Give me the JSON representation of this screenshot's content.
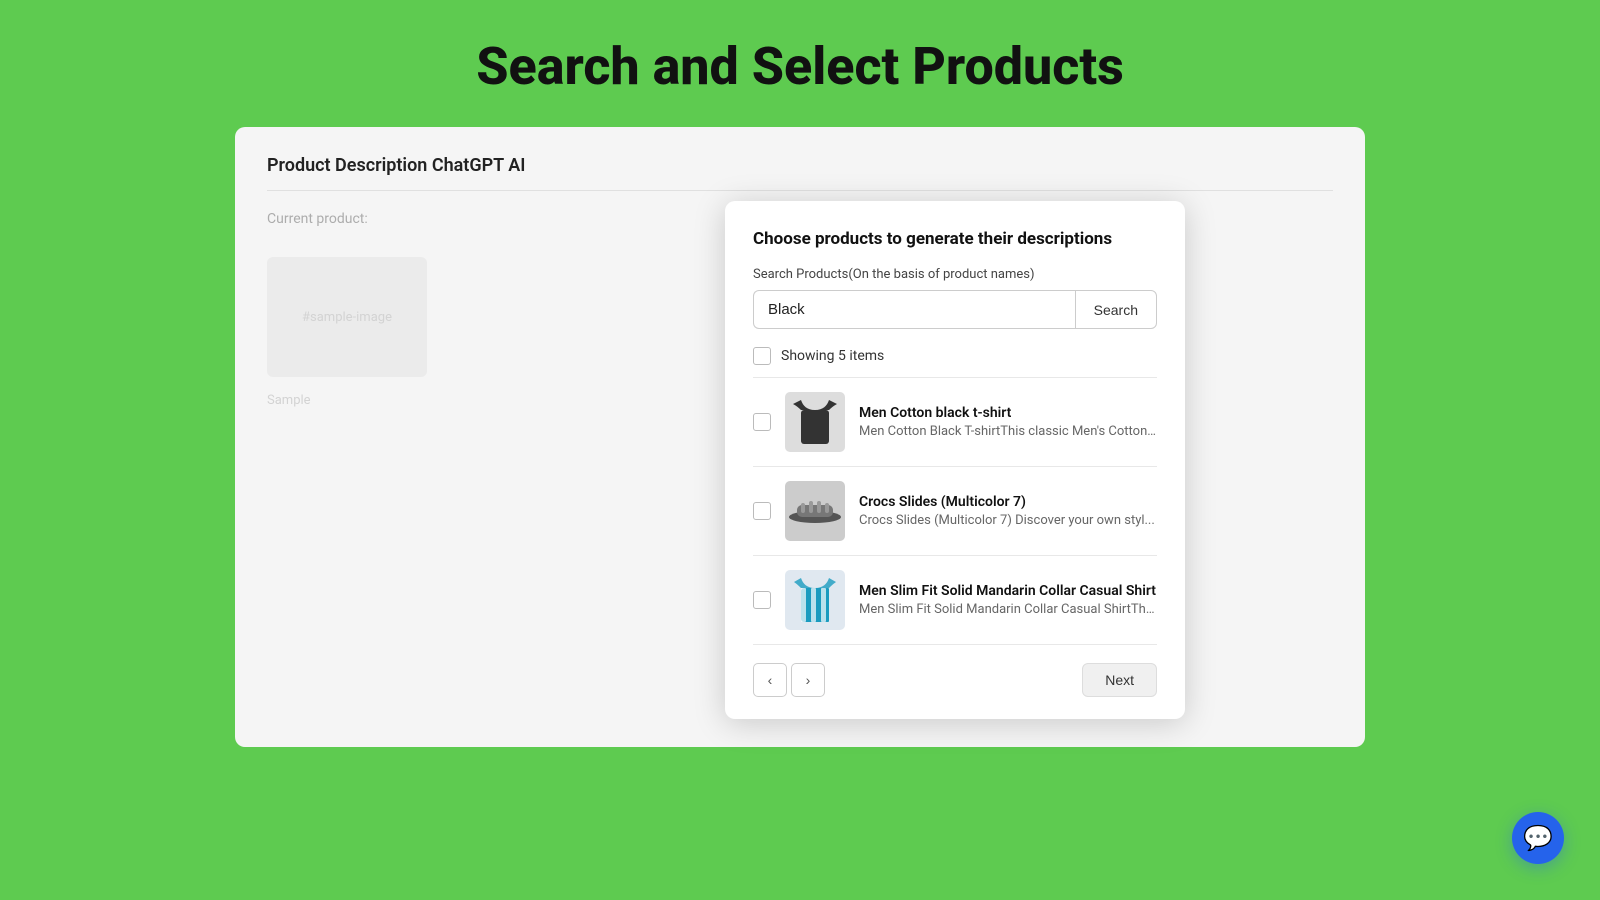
{
  "page": {
    "title": "Search and Select Products"
  },
  "app": {
    "header": "Product Description ChatGPT AI",
    "left_panel": {
      "label": "Current product:",
      "sample_image": "#sample-image",
      "sample_text": "Sample"
    }
  },
  "modal": {
    "title": "Choose products to generate their descriptions",
    "search_label": "Search Products(On the basis of product names)",
    "search_placeholder": "Black",
    "search_value": "Black",
    "search_button": "Search",
    "items_count_label": "Showing 5 items",
    "products": [
      {
        "id": 1,
        "name": "Men Cotton black t-shirt",
        "description": "Men Cotton Black T-shirtThis classic Men's Cotton ...",
        "image_type": "tshirt"
      },
      {
        "id": 2,
        "name": "Crocs Slides (Multicolor 7)",
        "description": "Crocs Slides (Multicolor 7) Discover your own styl...",
        "image_type": "slides"
      },
      {
        "id": 3,
        "name": "Men Slim Fit Solid Mandarin Collar Casual Shirt",
        "description": "Men Slim Fit Solid Mandarin Collar Casual ShirtThi...",
        "image_type": "shirt"
      }
    ],
    "next_button": "Next",
    "prev_arrow": "‹",
    "next_arrow": "›"
  },
  "chat": {
    "icon": "💬"
  }
}
